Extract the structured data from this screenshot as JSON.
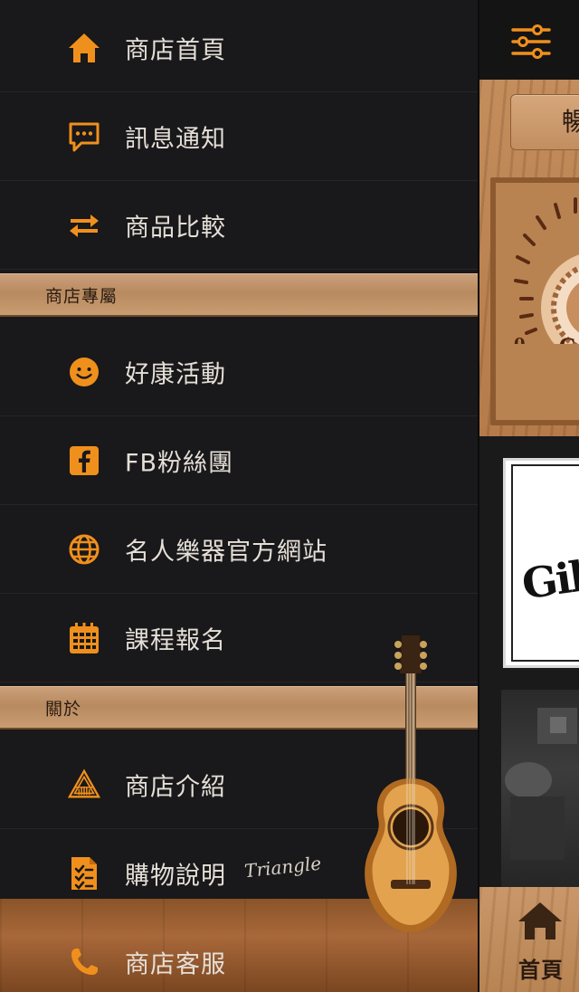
{
  "drawer": {
    "items_main": [
      {
        "label": "商店首頁",
        "icon": "home-icon"
      },
      {
        "label": "訊息通知",
        "icon": "message-icon"
      },
      {
        "label": "商品比較",
        "icon": "compare-arrows-icon"
      }
    ],
    "section_exclusive": {
      "title": "商店專屬"
    },
    "items_exclusive": [
      {
        "label": "好康活動",
        "icon": "smiley-icon"
      },
      {
        "label": "FB粉絲團",
        "icon": "facebook-icon"
      },
      {
        "label": "名人樂器官方網站",
        "icon": "globe-icon"
      },
      {
        "label": "課程報名",
        "icon": "calendar-icon"
      }
    ],
    "section_about": {
      "title": "關於"
    },
    "items_about": [
      {
        "label": "商店介紹",
        "icon": "store-logo-icon"
      },
      {
        "label": "購物說明",
        "icon": "checklist-icon"
      },
      {
        "label": "商店客服",
        "icon": "phone-icon"
      }
    ],
    "signature": "Triangle",
    "accent_color": "#f0901c"
  },
  "peek": {
    "tab_label": "暢",
    "card_logo": "Gib",
    "home_tab_label": "首頁"
  }
}
